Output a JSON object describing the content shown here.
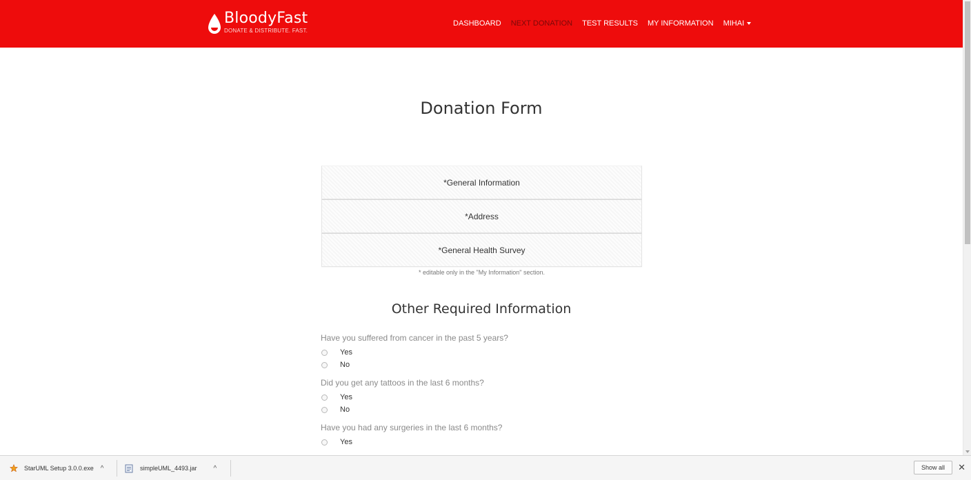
{
  "brand": {
    "name": "BloodyFast",
    "tagline": "DONATE & DISTRIBUTE. FAST.",
    "color": "#ee0c0c"
  },
  "nav": {
    "items": [
      {
        "label": "DASHBOARD",
        "active": false
      },
      {
        "label": "NEXT DONATION",
        "active": true
      },
      {
        "label": "TEST RESULTS",
        "active": false
      },
      {
        "label": "MY INFORMATION",
        "active": false
      },
      {
        "label": "MIHAI",
        "active": false
      }
    ]
  },
  "main": {
    "title": "Donation Form",
    "panels": [
      {
        "label": "*General Information"
      },
      {
        "label": "*Address"
      },
      {
        "label": "*General Health Survey"
      }
    ],
    "note": "* editable only in the \"My Information\" section.",
    "section_title": "Other Required Information",
    "questions": [
      {
        "text": "Have you suffered from cancer in the past 5 years?",
        "options": [
          "Yes",
          "No"
        ]
      },
      {
        "text": "Did you get any tattoos in the last 6 months?",
        "options": [
          "Yes",
          "No"
        ]
      },
      {
        "text": "Have you had any surgeries in the last 6 months?",
        "options": [
          "Yes"
        ]
      }
    ]
  },
  "downloads": {
    "items": [
      {
        "name": "StarUML Setup 3.0.0.exe",
        "icon": "staruml-icon"
      },
      {
        "name": "simpleUML_4493.jar",
        "icon": "jar-file-icon"
      }
    ],
    "show_all": "Show all"
  }
}
